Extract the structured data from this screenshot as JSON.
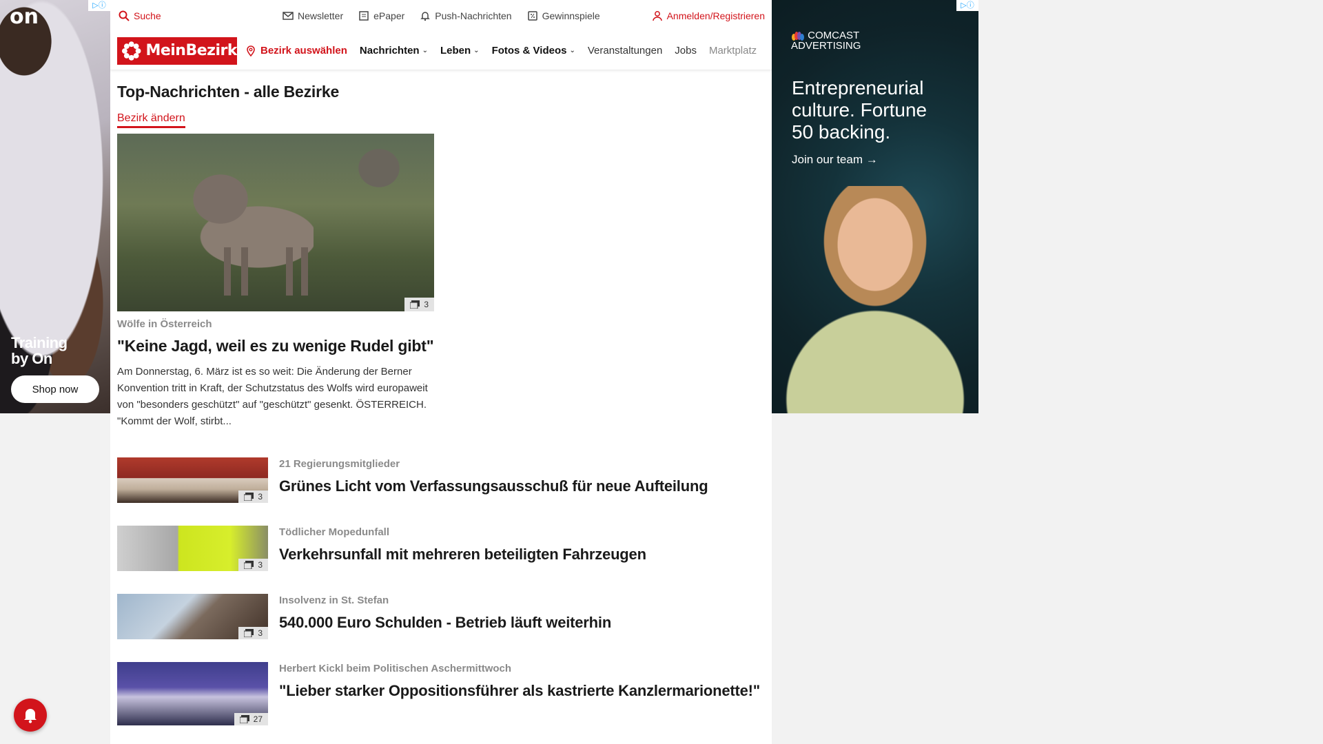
{
  "ads": {
    "left": {
      "logo": "on",
      "text_line1": "Training",
      "text_line2": "by On",
      "button": "Shop now"
    },
    "right": {
      "brand_line1": "COMCAST",
      "brand_line2": "ADVERTISING",
      "headline_line1": "Entrepreneurial",
      "headline_line2": "culture. Fortune",
      "headline_line3": "50 backing.",
      "cta": "Join our team →"
    }
  },
  "topbar": {
    "search": "Suche",
    "items": [
      "Newsletter",
      "ePaper",
      "Push-Nachrichten",
      "Gewinnspiele"
    ],
    "login": "Anmelden/Registrieren"
  },
  "nav": {
    "logo": "MeinBezirk",
    "bezirk": "Bezirk auswählen",
    "items": [
      "Nachrichten",
      "Leben",
      "Fotos & Videos",
      "Veranstaltungen",
      "Jobs",
      "Marktplatz"
    ]
  },
  "page": {
    "title": "Top-Nachrichten - alle Bezirke",
    "change_bezirk": "Bezirk ändern"
  },
  "hero": {
    "photo_count": "3",
    "kicker": "Wölfe in Österreich",
    "title": "\"Keine Jagd, weil es zu wenige Rudel gibt\"",
    "text": "Am Donnerstag, 6. März ist es so weit: Die Änderung der Berner Konvention tritt in Kraft, der Schutzstatus des Wolfs wird europaweit von \"besonders geschützt\" auf \"geschützt\" gesenkt.  ÖSTERREICH. \"Kommt der Wolf, stirbt..."
  },
  "articles": [
    {
      "kicker": "21 Regierungsmitglieder",
      "title": "Grünes Licht vom Verfassungsausschuß für neue Aufteilung",
      "photo_count": "3"
    },
    {
      "kicker": "Tödlicher Mopedunfall",
      "title": "Verkehrsunfall mit mehreren beteiligten Fahrzeugen",
      "photo_count": "3"
    },
    {
      "kicker": "Insolvenz in St. Stefan",
      "title": "540.000 Euro Schulden - Betrieb läuft weiterhin",
      "photo_count": "3"
    },
    {
      "kicker": "Herbert Kickl beim Politischen Aschermittwoch",
      "title": "\"Lieber starker Oppositionsführer als kastrierte Kanzlermarionette!\"",
      "photo_count": "27"
    }
  ],
  "colors": {
    "brand": "#d2141b",
    "text": "#1a1a1a",
    "kicker": "#8a8a8a"
  }
}
